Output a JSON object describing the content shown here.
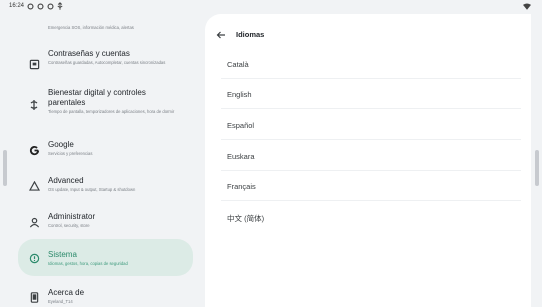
{
  "status": {
    "time": "16:24"
  },
  "sidebar": {
    "items": [
      {
        "title": "",
        "sub": "Emergencia SOS, información médica, alertas",
        "icon": "emergency-icon",
        "selected": false
      },
      {
        "title": "Contraseñas y cuentas",
        "sub": "Contraseñas guardadas, Autocompletar, cuentas sincronizadas",
        "icon": "passwords-icon",
        "selected": false
      },
      {
        "title": "Bienestar digital y controles parentales",
        "sub": "Tiempo de pantalla, temporizadores de aplicaciones, hora de dormir",
        "icon": "wellbeing-icon",
        "selected": false
      },
      {
        "title": "Google",
        "sub": "Servicios y preferencias",
        "icon": "google-icon",
        "selected": false
      },
      {
        "title": "Advanced",
        "sub": "OS update, Input & output, Startup & shutdown",
        "icon": "advanced-icon",
        "selected": false
      },
      {
        "title": "Administrator",
        "sub": "Control, security, store",
        "icon": "administrator-icon",
        "selected": false
      },
      {
        "title": "Sistema",
        "sub": "Idiomas, gestos, hora, copias de seguridad",
        "icon": "system-icon",
        "selected": true
      },
      {
        "title": "Acerca de",
        "sub": "Eyeland_T14",
        "icon": "about-icon",
        "selected": false
      }
    ]
  },
  "languages_page": {
    "title": "Idiomas",
    "languages": [
      "Català",
      "English",
      "Español",
      "Euskara",
      "Français",
      "中文 (简体)"
    ]
  },
  "colors": {
    "accent": "#2b8a6b",
    "selected_bg": "#dcebe6",
    "panel_bg": "#ffffff",
    "page_bg": "#f1f3f5"
  }
}
